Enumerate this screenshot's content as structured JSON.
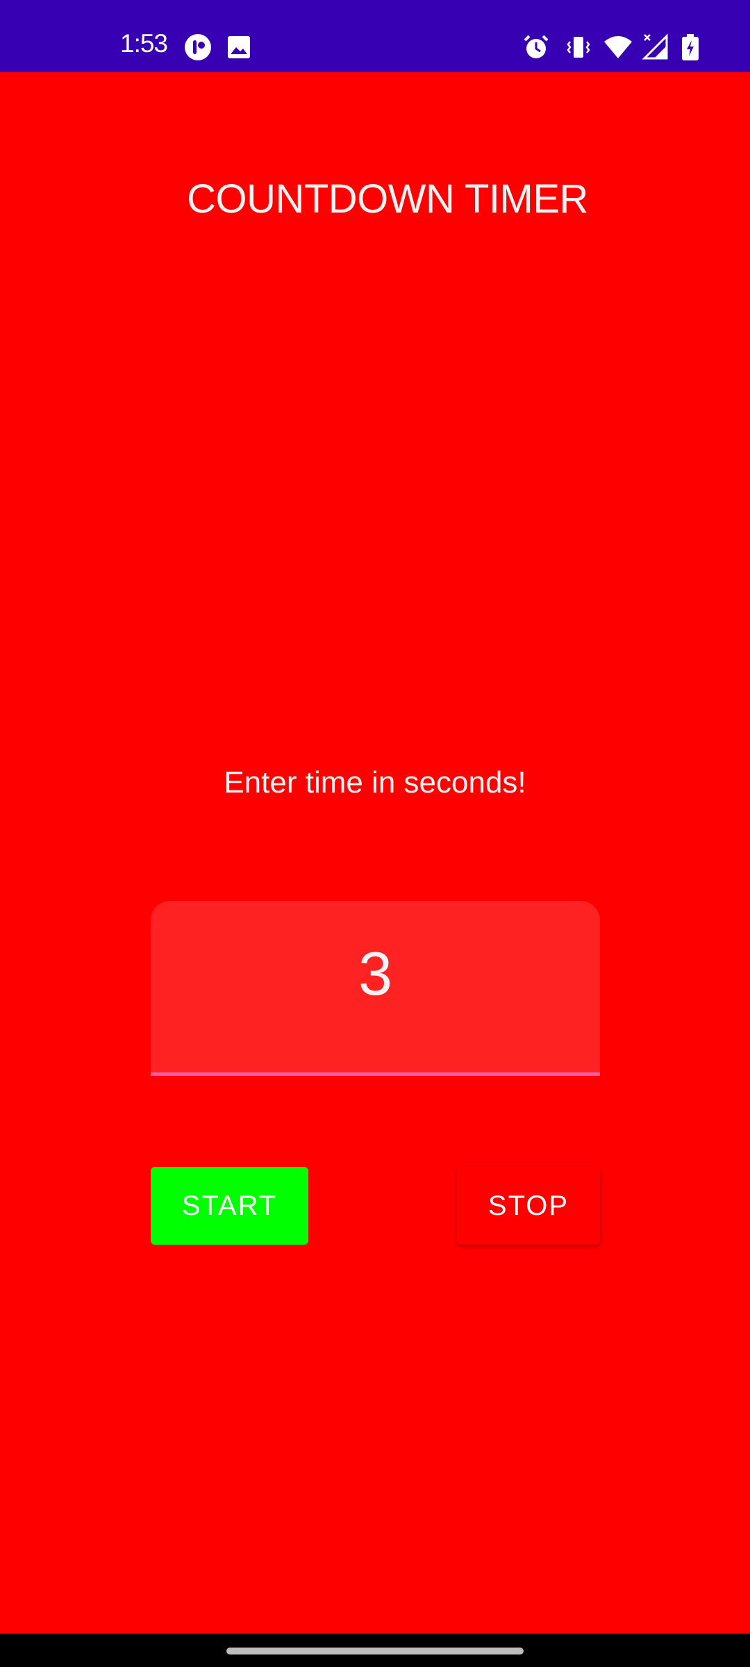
{
  "status_bar": {
    "time": "1:53",
    "icons": [
      "app-notification-icon",
      "image-notification-icon",
      "alarm-icon",
      "vibrate-icon",
      "wifi-icon",
      "signal-icon",
      "battery-charging-icon"
    ],
    "background": "#3700b3"
  },
  "app": {
    "title": "COUNTDOWN TIMER",
    "prompt": "Enter time in seconds!",
    "time_input": {
      "value": "3",
      "placeholder": ""
    },
    "start_label": "START",
    "stop_label": "STOP",
    "colors": {
      "background": "#ff0000",
      "start_button": "#00ff00",
      "stop_button": "#ff0000",
      "input_underline": "#ff5ea6"
    }
  }
}
